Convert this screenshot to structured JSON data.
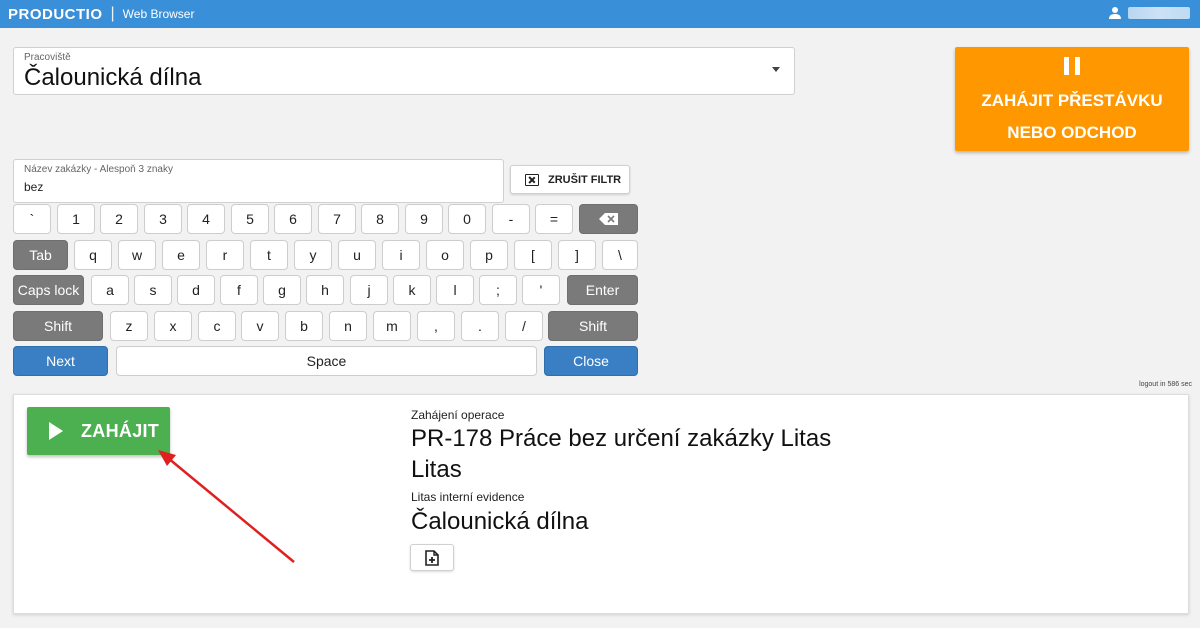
{
  "topbar": {
    "brand": "PRODUCTIO",
    "separator": "|",
    "app_name": "Web Browser",
    "user_icon": "user-icon",
    "color": "#3a8fd9"
  },
  "workplace": {
    "label": "Pracoviště",
    "value": "Čalounická dílna"
  },
  "pause_button": {
    "icon": "pause-icon",
    "line1": "ZAHÁJIT PŘESTÁVKU",
    "line2": "NEBO ODCHOD",
    "color": "#ff9800"
  },
  "search": {
    "label": "Název zakázky - Alespoň 3 znaky",
    "value": "bez"
  },
  "clear_filter": {
    "icon": "clear-box-icon",
    "label": "ZRUŠIT FILTR"
  },
  "keyboard": {
    "row1": [
      "`",
      "1",
      "2",
      "3",
      "4",
      "5",
      "6",
      "7",
      "8",
      "9",
      "0",
      "-",
      "="
    ],
    "backspace_icon": "backspace-icon",
    "row2_special": "Tab",
    "row2": [
      "q",
      "w",
      "e",
      "r",
      "t",
      "y",
      "u",
      "i",
      "o",
      "p",
      "[",
      "]",
      "\\"
    ],
    "row3_special": "Caps lock",
    "row3": [
      "a",
      "s",
      "d",
      "f",
      "g",
      "h",
      "j",
      "k",
      "l",
      ";",
      "'"
    ],
    "row3_enter": "Enter",
    "row4_shift_left": "Shift",
    "row4": [
      "z",
      "x",
      "c",
      "v",
      "b",
      "n",
      "m",
      ",",
      ".",
      "/"
    ],
    "row4_shift_right": "Shift",
    "next": "Next",
    "space": "Space",
    "close": "Close",
    "blue_color": "#3a7fc3",
    "dark_color": "#7a7a7a"
  },
  "logout_text": "logout in 586 sec",
  "operation": {
    "start_label": "ZAHÁJIT",
    "start_icon": "play-icon",
    "start_color": "#4caf50",
    "section_label": "Zahájení operace",
    "title_line1": "PR-178 Práce bez určení zakázky Litas",
    "title_line2": "Litas",
    "sub_label": "Litas interní evidence",
    "workplace": "Čalounická dílna",
    "doc_icon": "add-document-icon"
  },
  "annotation_color": "#e02020"
}
